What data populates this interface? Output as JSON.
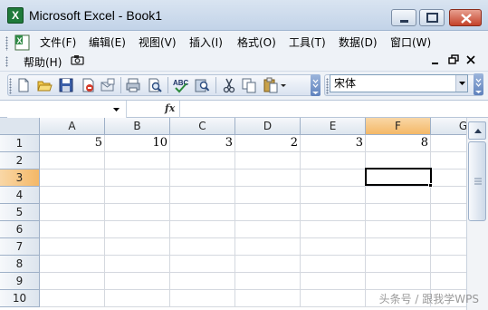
{
  "window": {
    "title": "Microsoft Excel - Book1",
    "app_icon_letter": "X",
    "controls": [
      "minimize-icon",
      "maximize-icon",
      "close-icon"
    ]
  },
  "menu": {
    "items": [
      "文件(F)",
      "编辑(E)",
      "视图(V)",
      "插入(I)",
      "格式(O)",
      "工具(T)",
      "数据(D)",
      "窗口(W)"
    ],
    "help": "帮助(H)",
    "mdi_controls": [
      "minimize-icon",
      "restore-icon",
      "close-icon"
    ]
  },
  "toolbar": {
    "icons": [
      "new-icon",
      "open-icon",
      "save-icon",
      "permission-icon",
      "email-icon",
      "print-icon",
      "print-preview-icon",
      "spelling-icon",
      "research-icon",
      "cut-icon",
      "copy-icon",
      "paste-icon",
      "format-painter-dropdown-icon"
    ],
    "font_name": "宋体"
  },
  "formula_bar": {
    "name_box": "",
    "fx_label": "fx",
    "content": ""
  },
  "sheet": {
    "columns": [
      "A",
      "B",
      "C",
      "D",
      "E",
      "F",
      "G"
    ],
    "rows": [
      "1",
      "2",
      "3",
      "4",
      "5",
      "6",
      "7",
      "8",
      "9",
      "10"
    ],
    "selected_column": "F",
    "selected_row": "3",
    "active_cell": "F3",
    "row1_values": [
      "5",
      "10",
      "3",
      "2",
      "3",
      "8"
    ]
  },
  "watermark": "头条号 / 跟我学WPS",
  "colors": {
    "title_bar": "#c2d3e8",
    "header_selected": "#f4b867",
    "close_button": "#c4422a"
  }
}
